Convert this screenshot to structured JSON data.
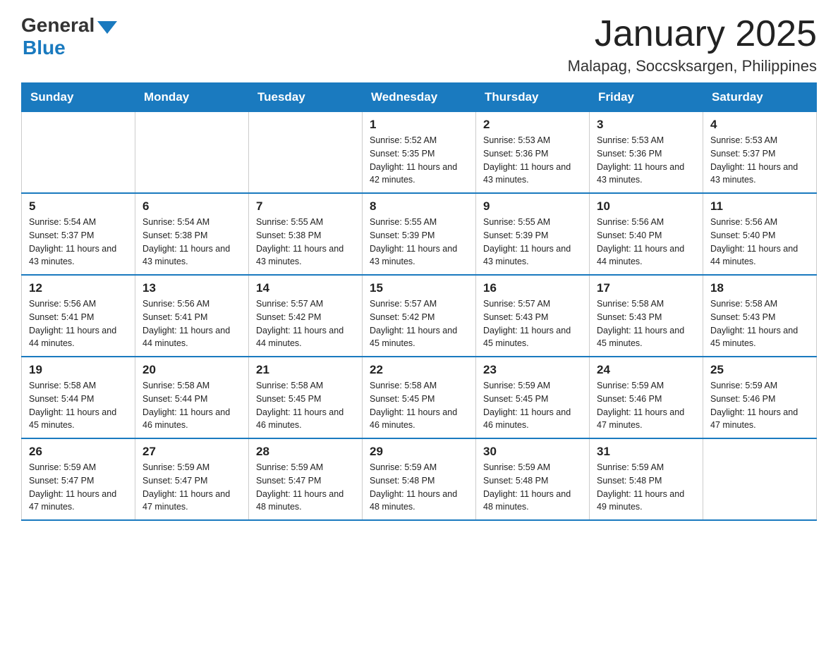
{
  "logo": {
    "general": "General",
    "blue": "Blue"
  },
  "title": "January 2025",
  "location": "Malapag, Soccsksargen, Philippines",
  "headers": [
    "Sunday",
    "Monday",
    "Tuesday",
    "Wednesday",
    "Thursday",
    "Friday",
    "Saturday"
  ],
  "weeks": [
    [
      {
        "day": "",
        "info": ""
      },
      {
        "day": "",
        "info": ""
      },
      {
        "day": "",
        "info": ""
      },
      {
        "day": "1",
        "info": "Sunrise: 5:52 AM\nSunset: 5:35 PM\nDaylight: 11 hours and 42 minutes."
      },
      {
        "day": "2",
        "info": "Sunrise: 5:53 AM\nSunset: 5:36 PM\nDaylight: 11 hours and 43 minutes."
      },
      {
        "day": "3",
        "info": "Sunrise: 5:53 AM\nSunset: 5:36 PM\nDaylight: 11 hours and 43 minutes."
      },
      {
        "day": "4",
        "info": "Sunrise: 5:53 AM\nSunset: 5:37 PM\nDaylight: 11 hours and 43 minutes."
      }
    ],
    [
      {
        "day": "5",
        "info": "Sunrise: 5:54 AM\nSunset: 5:37 PM\nDaylight: 11 hours and 43 minutes."
      },
      {
        "day": "6",
        "info": "Sunrise: 5:54 AM\nSunset: 5:38 PM\nDaylight: 11 hours and 43 minutes."
      },
      {
        "day": "7",
        "info": "Sunrise: 5:55 AM\nSunset: 5:38 PM\nDaylight: 11 hours and 43 minutes."
      },
      {
        "day": "8",
        "info": "Sunrise: 5:55 AM\nSunset: 5:39 PM\nDaylight: 11 hours and 43 minutes."
      },
      {
        "day": "9",
        "info": "Sunrise: 5:55 AM\nSunset: 5:39 PM\nDaylight: 11 hours and 43 minutes."
      },
      {
        "day": "10",
        "info": "Sunrise: 5:56 AM\nSunset: 5:40 PM\nDaylight: 11 hours and 44 minutes."
      },
      {
        "day": "11",
        "info": "Sunrise: 5:56 AM\nSunset: 5:40 PM\nDaylight: 11 hours and 44 minutes."
      }
    ],
    [
      {
        "day": "12",
        "info": "Sunrise: 5:56 AM\nSunset: 5:41 PM\nDaylight: 11 hours and 44 minutes."
      },
      {
        "day": "13",
        "info": "Sunrise: 5:56 AM\nSunset: 5:41 PM\nDaylight: 11 hours and 44 minutes."
      },
      {
        "day": "14",
        "info": "Sunrise: 5:57 AM\nSunset: 5:42 PM\nDaylight: 11 hours and 44 minutes."
      },
      {
        "day": "15",
        "info": "Sunrise: 5:57 AM\nSunset: 5:42 PM\nDaylight: 11 hours and 45 minutes."
      },
      {
        "day": "16",
        "info": "Sunrise: 5:57 AM\nSunset: 5:43 PM\nDaylight: 11 hours and 45 minutes."
      },
      {
        "day": "17",
        "info": "Sunrise: 5:58 AM\nSunset: 5:43 PM\nDaylight: 11 hours and 45 minutes."
      },
      {
        "day": "18",
        "info": "Sunrise: 5:58 AM\nSunset: 5:43 PM\nDaylight: 11 hours and 45 minutes."
      }
    ],
    [
      {
        "day": "19",
        "info": "Sunrise: 5:58 AM\nSunset: 5:44 PM\nDaylight: 11 hours and 45 minutes."
      },
      {
        "day": "20",
        "info": "Sunrise: 5:58 AM\nSunset: 5:44 PM\nDaylight: 11 hours and 46 minutes."
      },
      {
        "day": "21",
        "info": "Sunrise: 5:58 AM\nSunset: 5:45 PM\nDaylight: 11 hours and 46 minutes."
      },
      {
        "day": "22",
        "info": "Sunrise: 5:58 AM\nSunset: 5:45 PM\nDaylight: 11 hours and 46 minutes."
      },
      {
        "day": "23",
        "info": "Sunrise: 5:59 AM\nSunset: 5:45 PM\nDaylight: 11 hours and 46 minutes."
      },
      {
        "day": "24",
        "info": "Sunrise: 5:59 AM\nSunset: 5:46 PM\nDaylight: 11 hours and 47 minutes."
      },
      {
        "day": "25",
        "info": "Sunrise: 5:59 AM\nSunset: 5:46 PM\nDaylight: 11 hours and 47 minutes."
      }
    ],
    [
      {
        "day": "26",
        "info": "Sunrise: 5:59 AM\nSunset: 5:47 PM\nDaylight: 11 hours and 47 minutes."
      },
      {
        "day": "27",
        "info": "Sunrise: 5:59 AM\nSunset: 5:47 PM\nDaylight: 11 hours and 47 minutes."
      },
      {
        "day": "28",
        "info": "Sunrise: 5:59 AM\nSunset: 5:47 PM\nDaylight: 11 hours and 48 minutes."
      },
      {
        "day": "29",
        "info": "Sunrise: 5:59 AM\nSunset: 5:48 PM\nDaylight: 11 hours and 48 minutes."
      },
      {
        "day": "30",
        "info": "Sunrise: 5:59 AM\nSunset: 5:48 PM\nDaylight: 11 hours and 48 minutes."
      },
      {
        "day": "31",
        "info": "Sunrise: 5:59 AM\nSunset: 5:48 PM\nDaylight: 11 hours and 49 minutes."
      },
      {
        "day": "",
        "info": ""
      }
    ]
  ]
}
